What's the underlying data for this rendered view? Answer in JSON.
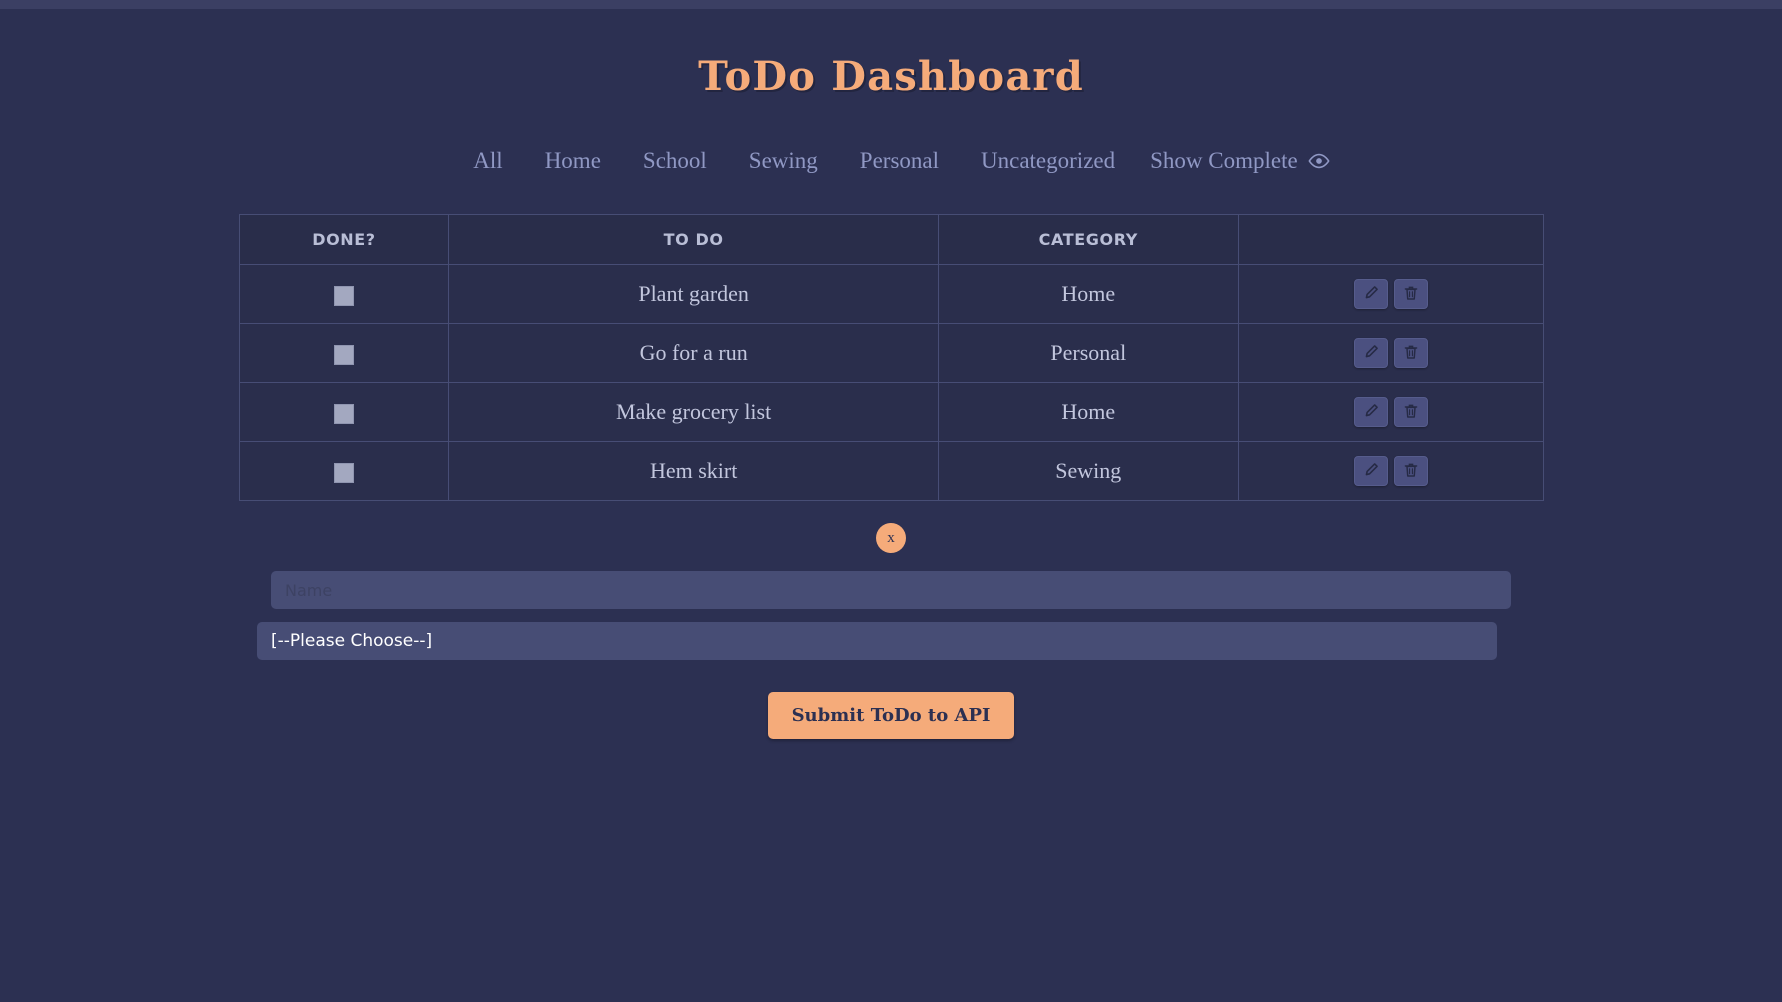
{
  "header": {
    "title": "ToDo Dashboard"
  },
  "nav": {
    "items": [
      {
        "label": "All"
      },
      {
        "label": "Home"
      },
      {
        "label": "School"
      },
      {
        "label": "Sewing"
      },
      {
        "label": "Personal"
      },
      {
        "label": "Uncategorized"
      }
    ],
    "show_complete_label": "Show Complete",
    "show_complete_icon": "eye-icon"
  },
  "table": {
    "columns": [
      "DONE?",
      "TO DO",
      "CATEGORY",
      ""
    ],
    "rows": [
      {
        "done": false,
        "todo": "Plant garden",
        "category": "Home",
        "edit_icon": "pencil-icon",
        "delete_icon": "trash-icon"
      },
      {
        "done": false,
        "todo": "Go for a run",
        "category": "Personal",
        "edit_icon": "pencil-icon",
        "delete_icon": "trash-icon"
      },
      {
        "done": false,
        "todo": "Make grocery list",
        "category": "Home",
        "edit_icon": "pencil-icon",
        "delete_icon": "trash-icon"
      },
      {
        "done": false,
        "todo": "Hem skirt",
        "category": "Sewing",
        "edit_icon": "pencil-icon",
        "delete_icon": "trash-icon"
      }
    ]
  },
  "form": {
    "close_label": "x",
    "name_placeholder": "Name",
    "name_value": "",
    "category_selected": "[--Please Choose--]",
    "submit_label": "Submit ToDo to API"
  },
  "colors": {
    "page_bg": "#2c3052",
    "top_strip": "#3b3f63",
    "accent": "#f5ab7a",
    "nav_link": "#9098c4",
    "table_border": "#474d75",
    "table_bg": "#2a2e4c",
    "input_bg": "#474d75",
    "checkbox": "#a3a8c0",
    "icon_btn_bg": "#4b5080"
  }
}
